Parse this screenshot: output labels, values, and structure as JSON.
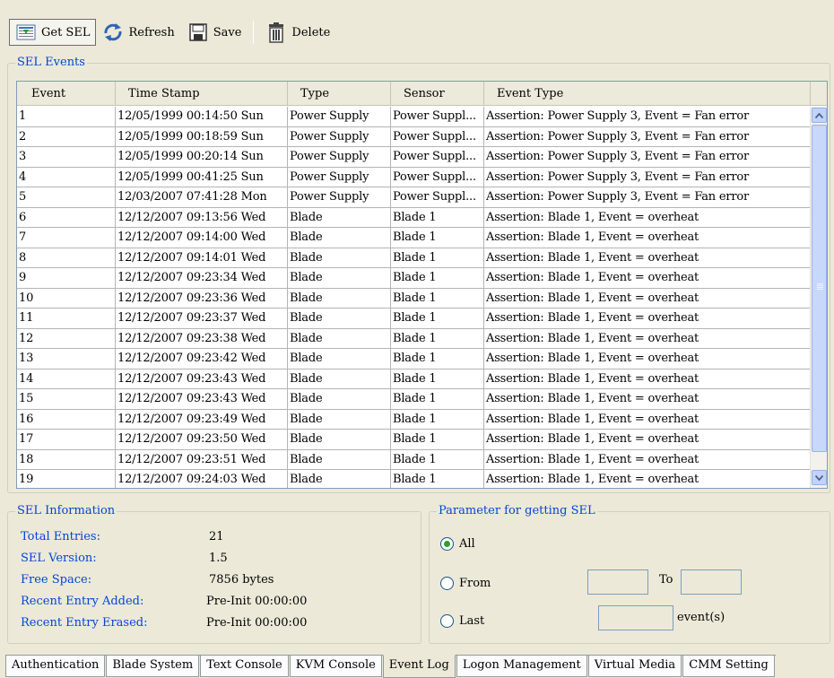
{
  "toolbar": {
    "get_sel": "Get SEL",
    "refresh": "Refresh",
    "save": "Save",
    "delete": "Delete"
  },
  "sel_events": {
    "legend": "SEL Events",
    "columns": [
      "Event",
      "Time Stamp",
      "Type",
      "Sensor",
      "Event Type"
    ],
    "rows": [
      [
        "1",
        "12/05/1999 00:14:50 Sun",
        "Power Supply",
        "Power Suppl...",
        "Assertion: Power Supply 3, Event = Fan error"
      ],
      [
        "2",
        "12/05/1999 00:18:59 Sun",
        "Power Supply",
        "Power Suppl...",
        "Assertion: Power Supply 3, Event = Fan error"
      ],
      [
        "3",
        "12/05/1999 00:20:14 Sun",
        "Power Supply",
        "Power Suppl...",
        "Assertion: Power Supply 3, Event = Fan error"
      ],
      [
        "4",
        "12/05/1999 00:41:25 Sun",
        "Power Supply",
        "Power Suppl...",
        "Assertion: Power Supply 3, Event = Fan error"
      ],
      [
        "5",
        "12/03/2007 07:41:28 Mon",
        "Power Supply",
        "Power Suppl...",
        "Assertion: Power Supply 3, Event = Fan error"
      ],
      [
        "6",
        "12/12/2007 09:13:56 Wed",
        "Blade",
        "Blade 1",
        "Assertion: Blade 1, Event = overheat"
      ],
      [
        "7",
        "12/12/2007 09:14:00 Wed",
        "Blade",
        "Blade 1",
        "Assertion: Blade 1, Event = overheat"
      ],
      [
        "8",
        "12/12/2007 09:14:01 Wed",
        "Blade",
        "Blade 1",
        "Assertion: Blade 1, Event = overheat"
      ],
      [
        "9",
        "12/12/2007 09:23:34 Wed",
        "Blade",
        "Blade 1",
        "Assertion: Blade 1, Event = overheat"
      ],
      [
        "10",
        "12/12/2007 09:23:36 Wed",
        "Blade",
        "Blade 1",
        "Assertion: Blade 1, Event = overheat"
      ],
      [
        "11",
        "12/12/2007 09:23:37 Wed",
        "Blade",
        "Blade 1",
        "Assertion: Blade 1, Event = overheat"
      ],
      [
        "12",
        "12/12/2007 09:23:38 Wed",
        "Blade",
        "Blade 1",
        "Assertion: Blade 1, Event = overheat"
      ],
      [
        "13",
        "12/12/2007 09:23:42 Wed",
        "Blade",
        "Blade 1",
        "Assertion: Blade 1, Event = overheat"
      ],
      [
        "14",
        "12/12/2007 09:23:43 Wed",
        "Blade",
        "Blade 1",
        "Assertion: Blade 1, Event = overheat"
      ],
      [
        "15",
        "12/12/2007 09:23:43 Wed",
        "Blade",
        "Blade 1",
        "Assertion: Blade 1, Event = overheat"
      ],
      [
        "16",
        "12/12/2007 09:23:49 Wed",
        "Blade",
        "Blade 1",
        "Assertion: Blade 1, Event = overheat"
      ],
      [
        "17",
        "12/12/2007 09:23:50 Wed",
        "Blade",
        "Blade 1",
        "Assertion: Blade 1, Event = overheat"
      ],
      [
        "18",
        "12/12/2007 09:23:51 Wed",
        "Blade",
        "Blade 1",
        "Assertion: Blade 1, Event = overheat"
      ],
      [
        "19",
        "12/12/2007 09:24:03 Wed",
        "Blade",
        "Blade 1",
        "Assertion: Blade 1, Event = overheat"
      ]
    ]
  },
  "sel_info": {
    "legend": "SEL Information",
    "total_entries_label": "Total Entries:",
    "total_entries": "21",
    "sel_version_label": "SEL Version:",
    "sel_version": "1.5",
    "free_space_label": "Free Space:",
    "free_space": "7856 bytes",
    "recent_added_label": "Recent Entry Added:",
    "recent_added": "Pre-Init 00:00:00",
    "recent_erased_label": "Recent Entry Erased:",
    "recent_erased": "Pre-Init 00:00:00"
  },
  "params": {
    "legend": "Parameter for getting SEL",
    "all_label": "All",
    "from_label": "From",
    "to_label": "To",
    "last_label": "Last",
    "events_suffix": "event(s)",
    "selected": "All",
    "from_value": "",
    "to_value": "",
    "last_value": ""
  },
  "tabs": {
    "items": [
      "Authentication",
      "Blade System",
      "Text Console",
      "KVM Console",
      "Event Log",
      "Logon Management",
      "Virtual Media",
      "CMM Setting"
    ],
    "active": "Event Log"
  },
  "colors": {
    "label_blue": "#0046d5",
    "background": "#ece9d8",
    "radio_selected": "#2f9e2f"
  }
}
